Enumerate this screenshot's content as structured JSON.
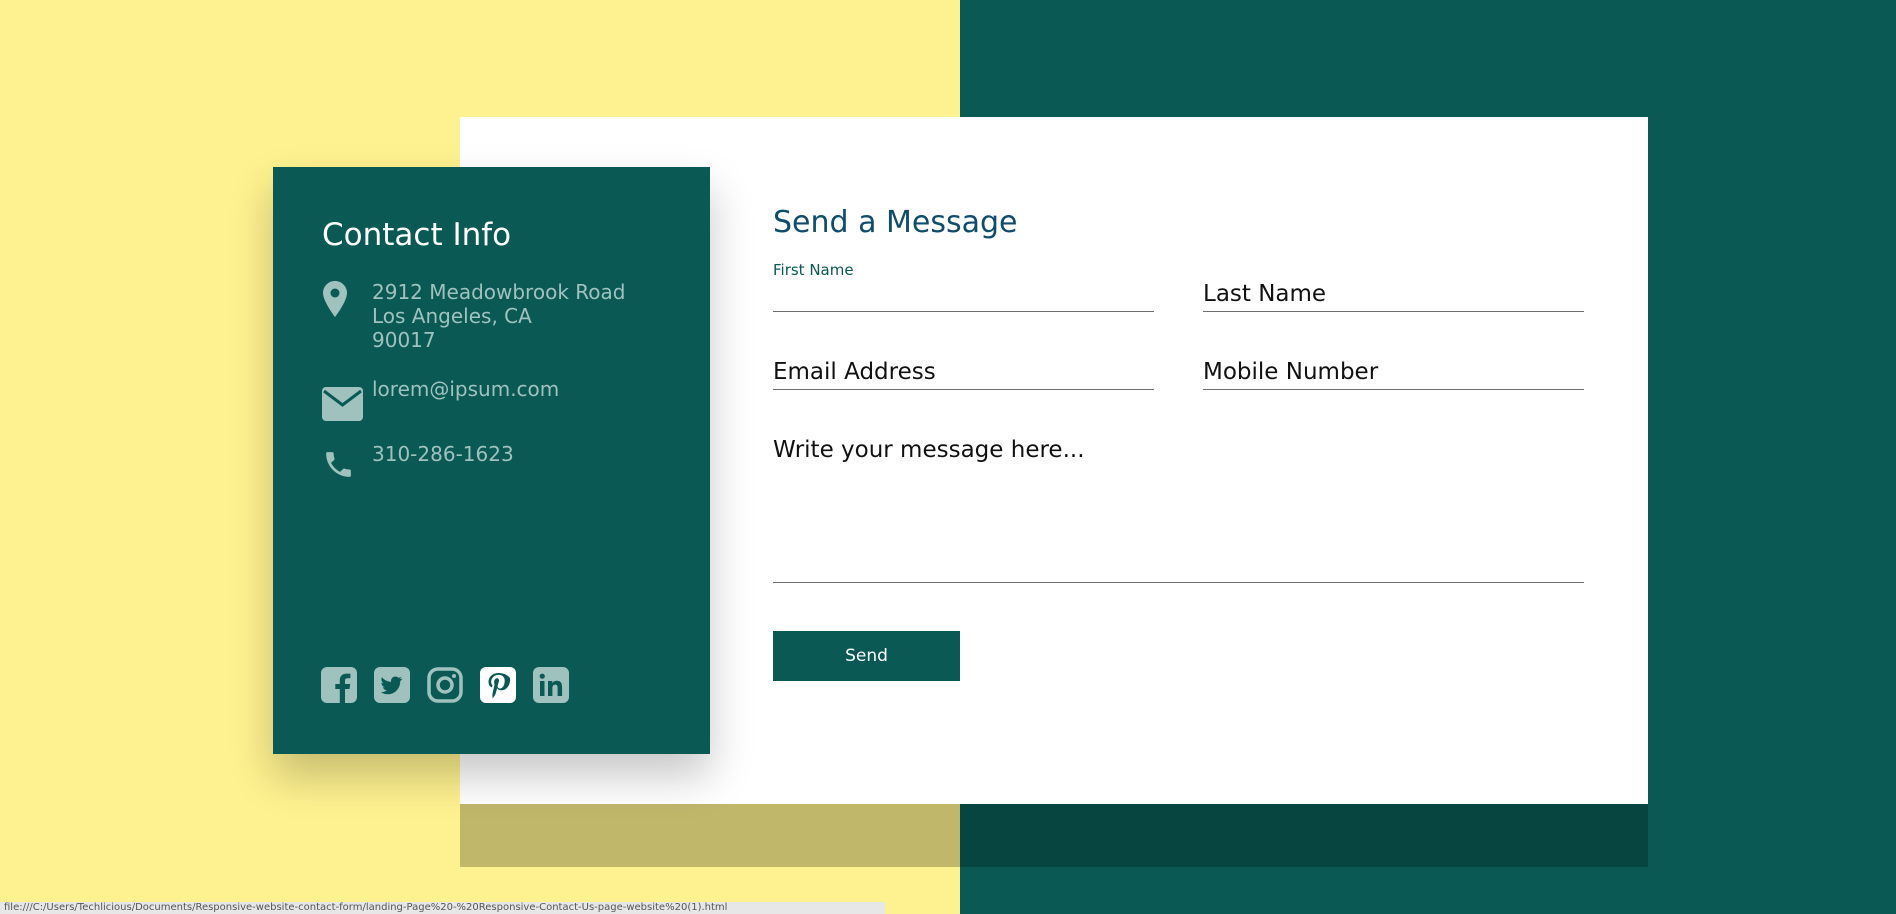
{
  "contact_info": {
    "title": "Contact Info",
    "address_line1": "2912 Meadowbrook Road",
    "address_line2": "Los Angeles, CA",
    "address_line3": "90017",
    "email": "lorem@ipsum.com",
    "phone": "310-286-1623",
    "icons": [
      "location-pin-icon",
      "envelope-icon",
      "phone-icon"
    ],
    "social": [
      "facebook-icon",
      "twitter-icon",
      "instagram-icon",
      "pinterest-icon",
      "linkedin-icon"
    ]
  },
  "form": {
    "title": "Send a Message",
    "first_name_label": "First Name",
    "first_name_value": "",
    "last_name_placeholder": "Last Name",
    "email_placeholder": "Email Address",
    "mobile_placeholder": "Mobile Number",
    "message_placeholder": "Write your message here...",
    "send_label": "Send"
  },
  "colors": {
    "yellow": "#fef18f",
    "teal": "#0a5955",
    "dark_teal": "#074541",
    "olive": "#c0b76b",
    "icon": "#9fc2be",
    "title_blue": "#0f4d6b"
  },
  "statusbar": {
    "text": "file:///C:/Users/Techlicious/Documents/Responsive-website-contact-form/landing-Page%20-%20Responsive-Contact-Us-page-website%20(1).html"
  }
}
